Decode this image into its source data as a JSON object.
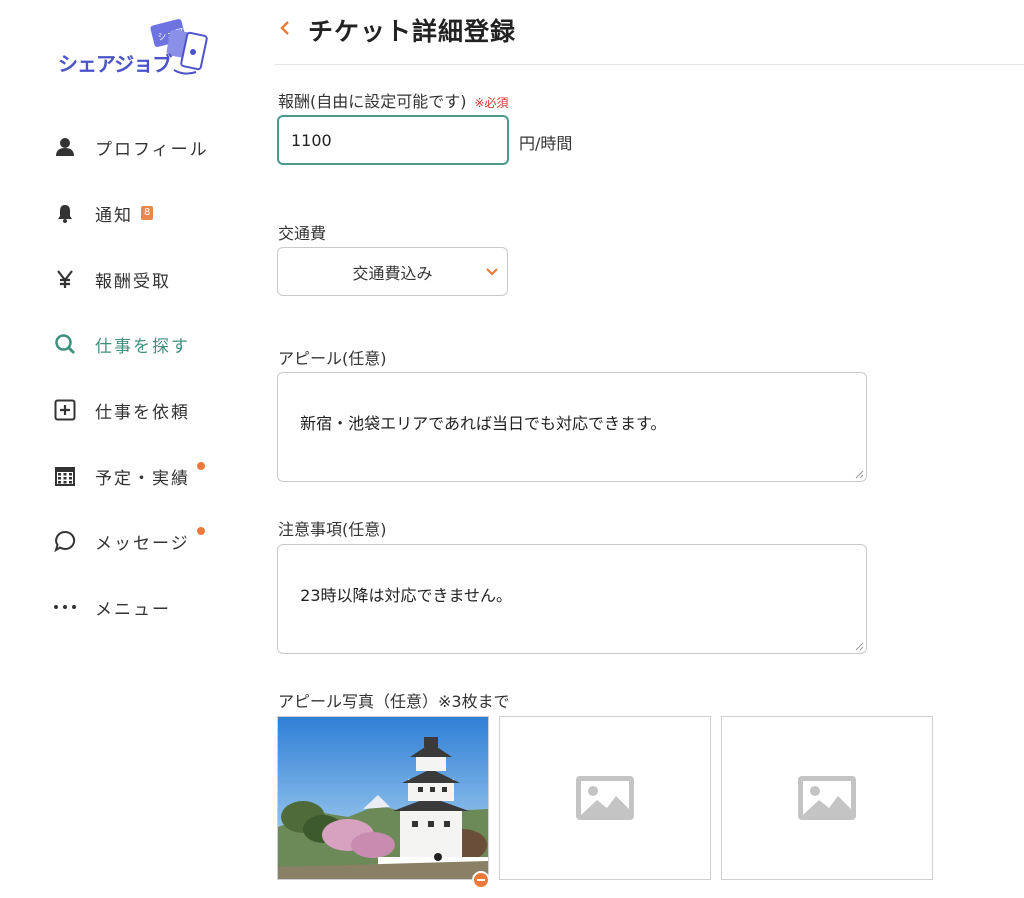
{
  "app": {
    "logo_text": "シェアジョブ",
    "logo_mark": "シェアジョブ"
  },
  "sidebar": {
    "items": [
      {
        "label": "プロフィール",
        "icon": "person-icon"
      },
      {
        "label": "通知",
        "icon": "bell-icon",
        "badge": "8"
      },
      {
        "label": "報酬受取",
        "icon": "yen-icon"
      },
      {
        "label": "仕事を探す",
        "icon": "search-icon",
        "active": true
      },
      {
        "label": "仕事を依頼",
        "icon": "plus-square-icon"
      },
      {
        "label": "予定・実績",
        "icon": "calendar-icon",
        "dot": true
      },
      {
        "label": "メッセージ",
        "icon": "chat-bubble-icon",
        "dot": true
      },
      {
        "label": "メニュー",
        "icon": "more-dots-icon"
      }
    ]
  },
  "header": {
    "title": "チケット詳細登録"
  },
  "form": {
    "reward": {
      "label": "報酬(自由に設定可能です)",
      "required": "※必須",
      "value": "1100",
      "unit": "円/時間"
    },
    "transport": {
      "label": "交通費",
      "selected": "交通費込み"
    },
    "appeal": {
      "label": "アピール(任意)",
      "value": "新宿・池袋エリアであれば当日でも対応できます。"
    },
    "notes": {
      "label": "注意事項(任意)",
      "value": "23時以降は対応できません。"
    },
    "photos": {
      "label": "アピール写真（任意）※3枚まで",
      "filled": 1,
      "max": 3
    }
  },
  "colors": {
    "accent_green": "#4a9a8a",
    "accent_orange": "#ec7a3b",
    "brand_blue": "#4b53c8",
    "required_red": "#d63a2f"
  }
}
